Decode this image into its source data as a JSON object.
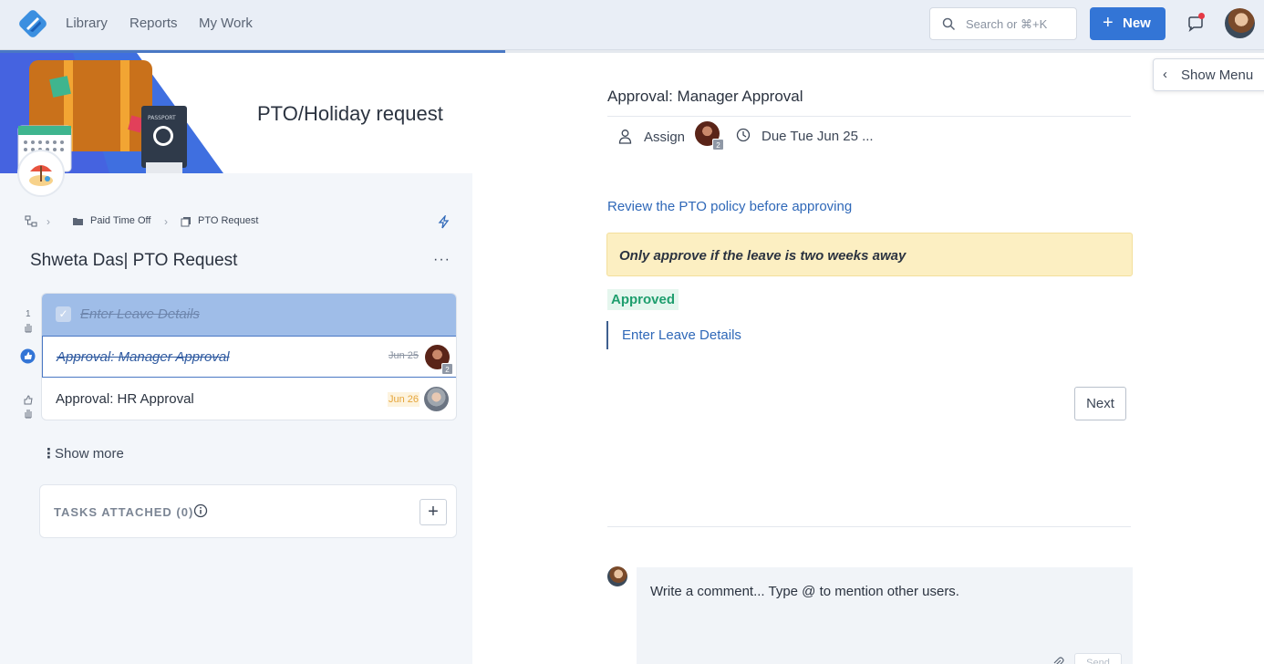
{
  "nav": {
    "links": [
      "Library",
      "Reports",
      "My Work"
    ],
    "search_placeholder": "Search or ⌘+K",
    "new_label": "New"
  },
  "progress": {
    "fraction": 0.4
  },
  "banner": {
    "title": "PTO/Holiday request"
  },
  "breadcrumb": {
    "folder": "Paid Time Off",
    "template": "PTO Request"
  },
  "run": {
    "title": "Shweta Das| PTO Request",
    "menu": "···"
  },
  "tasks": [
    {
      "num": "1",
      "title": "Enter Leave Details",
      "status": "completed",
      "due": ""
    },
    {
      "num": "",
      "title": "Approval: Manager Approval",
      "status": "completed-current",
      "due": "Jun 25",
      "badge": "2"
    },
    {
      "num": "",
      "title": "Approval: HR Approval",
      "status": "pending",
      "due": "Jun 26"
    }
  ],
  "show_more": "Show more",
  "attached": {
    "label": "TASKS ATTACHED (0)",
    "add": "+"
  },
  "task_detail": {
    "title": "Approval: Manager Approval",
    "assign": "Assign",
    "assign_badge": "2",
    "due": "Due Tue Jun 25 ...",
    "policy_link": "Review the PTO policy before approving",
    "callout": "Only approve if the leave is two weeks away",
    "status_badge": "Approved",
    "linked_task": "Enter Leave Details",
    "next": "Next"
  },
  "comment": {
    "placeholder": "Write a comment... Type @ to mention other users.",
    "send": "Send"
  },
  "show_menu": "Show Menu",
  "colors": {
    "accent": "#3375d6",
    "completed_row": "#9fbde8",
    "callout_bg": "#fcefc2",
    "approved_green": "#1f9e6e",
    "notification_dot": "#e53945"
  }
}
